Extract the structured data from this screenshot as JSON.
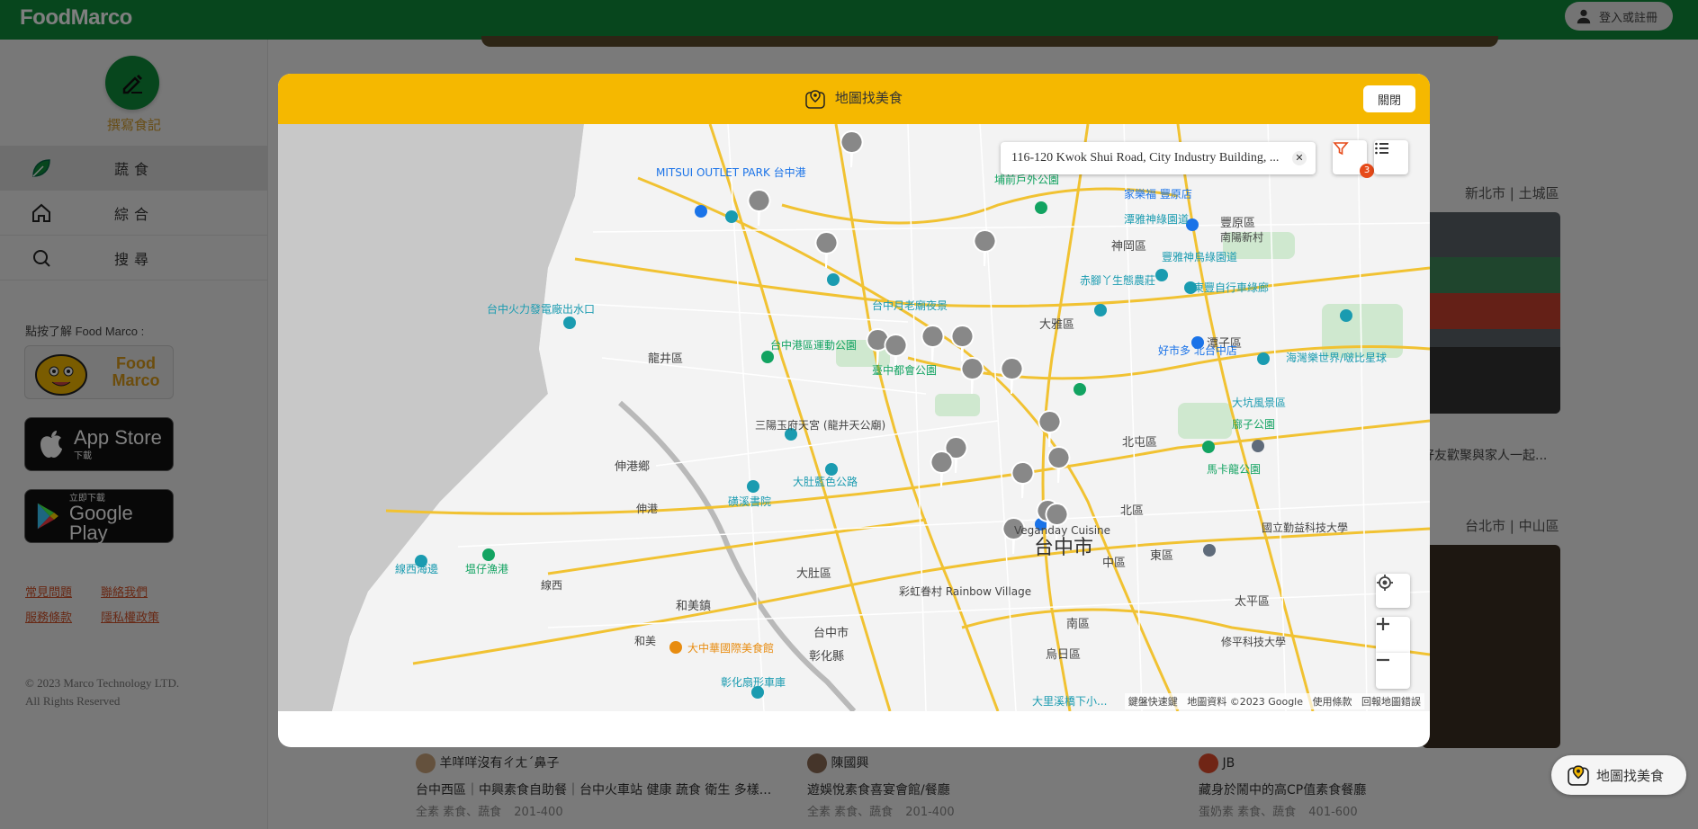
{
  "header": {
    "logo": "FoodMarco",
    "login_label": "登入或註冊"
  },
  "sidebar": {
    "write_label": "撰寫食記",
    "nav": [
      {
        "label": "蔬食",
        "icon": "leaf-icon"
      },
      {
        "label": "綜合",
        "icon": "home-icon"
      },
      {
        "label": "搜尋",
        "icon": "search-icon"
      }
    ],
    "learn_text": "點按了解 Food Marco :",
    "fm_card_label": "Food Marco",
    "app_store": {
      "big": "App Store",
      "small": "下載"
    },
    "google_play": {
      "big": "Google Play",
      "small": "立即下載"
    },
    "links": [
      "常見問題",
      "聯絡我們",
      "服務條款",
      "隱私權政策"
    ],
    "copyright_line1": "© 2023 Marco Technology LTD.",
    "copyright_line2": "All Rights Reserved"
  },
  "background_cards": {
    "right_top_location": "新北市 | 土城區",
    "right_top_snippet": "好友歡聚與家人一起...",
    "right_bottom_location": "台北市 | 中山區",
    "authors": [
      {
        "name": "羊咩咩沒有ㄔㄤˊ鼻子",
        "title": "台中西區｜中興素食自助餐｜台中火車站 健康 蔬食 衛生 多樣...",
        "tags": "全素 素食、蔬食",
        "price": "201-400"
      },
      {
        "name": "陳國興",
        "title": "遊娛悅素食喜宴會館/餐廳",
        "tags": "全素 素食、蔬食",
        "price": "201-400"
      },
      {
        "name": "JB",
        "title": "藏身於鬧中的高CP值素食餐廳",
        "tags": "蛋奶素 素食、蔬食",
        "price": "401-600"
      }
    ]
  },
  "modal": {
    "title": "地圖找美食",
    "close_label": "關閉",
    "search_value": "116-120 Kwok Shui Road, City Industry Building, ...",
    "clear_label": "✕",
    "filter_badge": "3",
    "attribution": [
      "鍵盤快速鍵",
      "地圖資料 ©2023 Google",
      "使用條款",
      "回報地圖錯誤"
    ],
    "map_labels": [
      "MITSUI OUTLET PARK 台中港",
      "台中火力發電廠出水口",
      "龍井區",
      "伸港鄉",
      "伸港",
      "線西海邊",
      "塭仔漁港",
      "線西",
      "和美鎮",
      "和美",
      "大肚區",
      "大肚藍色公路",
      "磺溪書院",
      "台中市",
      "彰化縣",
      "大中華國際美食館",
      "彰化扇形車庫",
      "台中港區運動公園",
      "台中月老廟夜景",
      "臺中都會公園",
      "三陽玉府天宮 (龍井天公廟)",
      "神岡區",
      "大雅區",
      "潭子區",
      "北屯區",
      "北區",
      "中區",
      "東區",
      "太平區",
      "南區",
      "烏日區",
      "豐原區",
      "南陽新村",
      "家樂福 豐原店",
      "赤腳丫生態農莊",
      "東豐自行車綠廊",
      "豐雅神鳥綠園道",
      "潭雅神綠園道",
      "好市多 北台中店",
      "大坑風景區",
      "廍子公園",
      "馬卡龍公園",
      "國立勤益科技大學",
      "修平科技大學",
      "彩虹眷村 Rainbow Village",
      "Veganday Cuisine",
      "台中市",
      "大里溪橋下小...",
      "海灣樂世界/啵比星球",
      "埔前戶外公園"
    ]
  },
  "float_button": {
    "label": "地圖找美食"
  },
  "colors": {
    "brand_green": "#0e8c3a",
    "modal_header": "#f5b800",
    "accent_orange": "#d0522a"
  }
}
